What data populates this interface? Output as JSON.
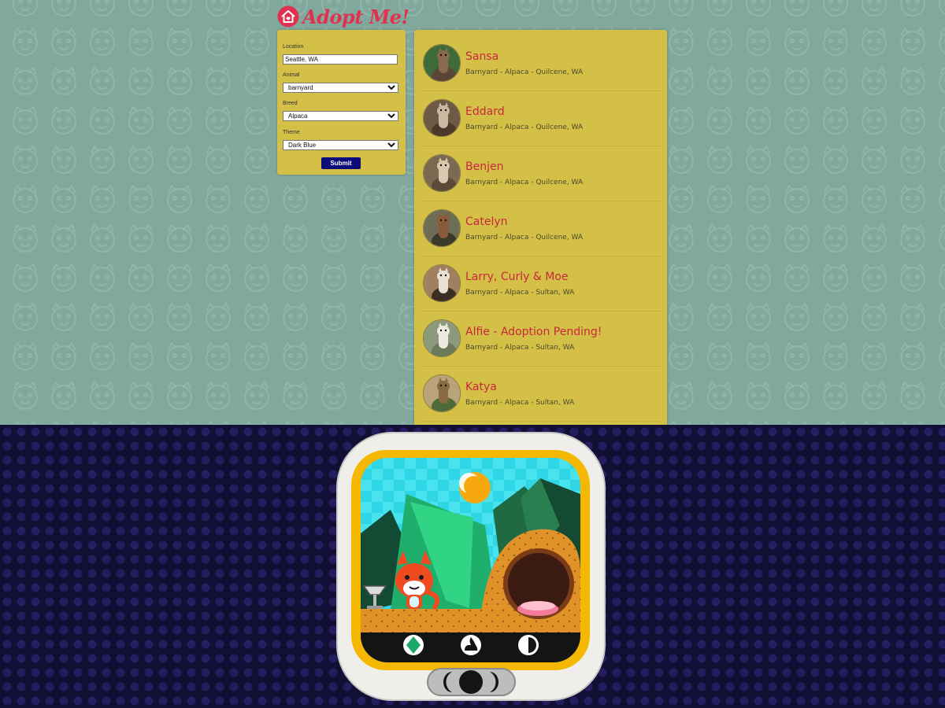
{
  "logo": {
    "text": "Adopt Me!",
    "icon": "house-heart-icon"
  },
  "search": {
    "location": {
      "label": "Location",
      "value": "Seattle, WA"
    },
    "animal": {
      "label": "Animal",
      "value": "barnyard"
    },
    "breed": {
      "label": "Breed",
      "value": "Alpaca"
    },
    "theme": {
      "label": "Theme",
      "value": "Dark Blue"
    },
    "submit_label": "Submit"
  },
  "pets": [
    {
      "name": "Sansa",
      "info": "Barnyard - Alpaca - Quilcene, WA"
    },
    {
      "name": "Eddard",
      "info": "Barnyard - Alpaca - Quilcene, WA"
    },
    {
      "name": "Benjen",
      "info": "Barnyard - Alpaca - Quilcene, WA"
    },
    {
      "name": "Catelyn",
      "info": "Barnyard - Alpaca - Quilcene, WA"
    },
    {
      "name": "Larry, Curly & Moe",
      "info": "Barnyard - Alpaca - Sultan, WA"
    },
    {
      "name": "Alfie - Adoption Pending!",
      "info": "Barnyard - Alpaca - Sultan, WA"
    },
    {
      "name": "Katya",
      "info": "Barnyard - Alpaca - Sultan, WA"
    }
  ],
  "colors": {
    "background": "#80a89c",
    "panel": "#d4bf47",
    "accent": "#c8283d",
    "button": "#0b0a7a",
    "bottom_background": "#120f35"
  },
  "app_icon": {
    "name": "virtual-pet-app-icon"
  }
}
